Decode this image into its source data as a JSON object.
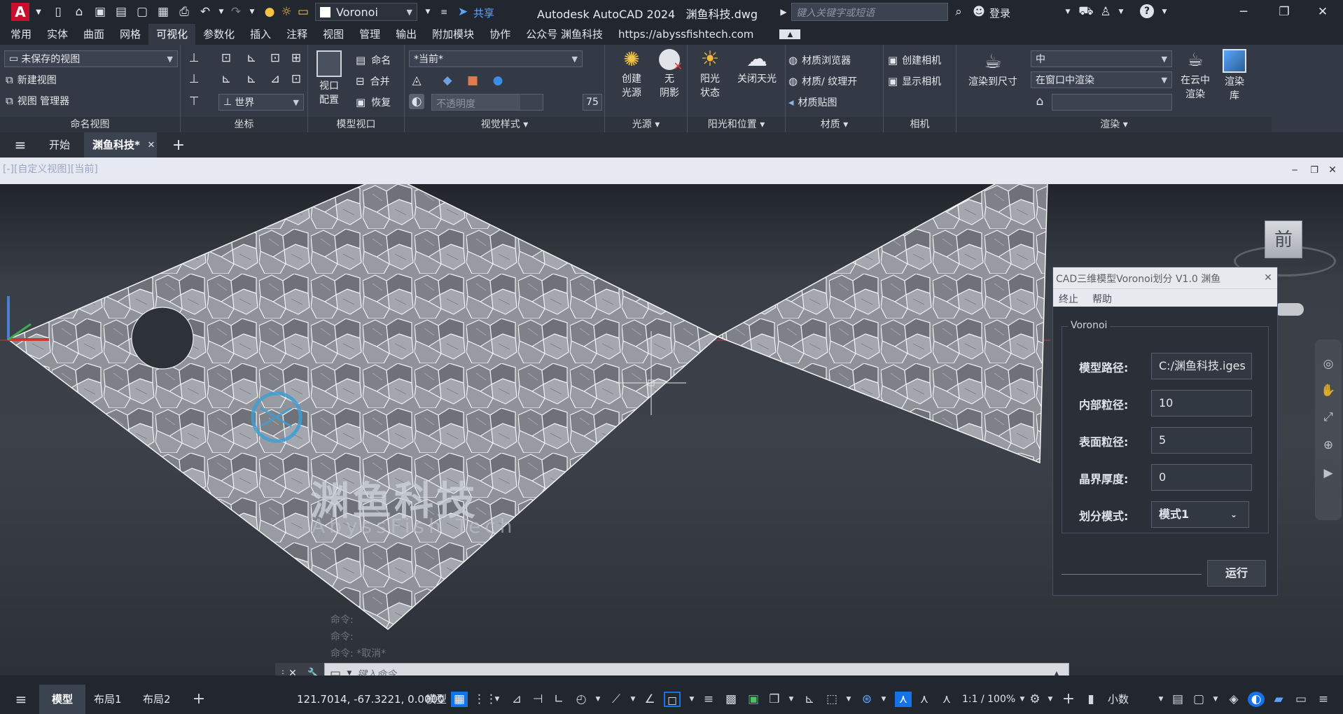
{
  "app": {
    "title": "Autodesk AutoCAD 2024   渊鱼科技.dwg",
    "logo_letter": "A",
    "workspace": "Voronoi",
    "share": "共享",
    "search_placeholder": "键入关键字或短语",
    "login": "登录"
  },
  "menu": {
    "items": [
      "常用",
      "实体",
      "曲面",
      "网格",
      "可视化",
      "参数化",
      "插入",
      "注释",
      "视图",
      "管理",
      "输出",
      "附加模块",
      "协作",
      "公众号 渊鱼科技",
      "https://abyssfishtech.com"
    ],
    "active": "可视化"
  },
  "ribbon": {
    "named_views": {
      "combo": "未保存的视图",
      "new_view": "新建视图",
      "view_manager": "视图 管理器",
      "panel": "命名视图"
    },
    "coordinates": {
      "world": "世界",
      "panel": "坐标"
    },
    "model_viewports": {
      "config": "视口\n配置",
      "config_l1": "视口",
      "config_l2": "配置",
      "name": "命名",
      "join": "合并",
      "restore": "恢复",
      "panel": "模型视口"
    },
    "visual_styles": {
      "current": "*当前*",
      "opacity_label": "不透明度",
      "opacity_value": "75",
      "panel": "视觉样式"
    },
    "lights": {
      "create_l1": "创建",
      "create_l2": "光源",
      "noshadow_l1": "无",
      "noshadow_l2": "阴影",
      "panel": "光源"
    },
    "sun": {
      "status_l1": "阳光",
      "status_l2": "状态",
      "sky_off": "关闭天光",
      "panel": "阳光和位置"
    },
    "materials": {
      "browser": "材质浏览器",
      "texture": "材质/ 纹理开",
      "mapping": "材质贴图",
      "panel": "材质"
    },
    "camera": {
      "create": "创建相机",
      "show": "显示相机",
      "panel": "相机"
    },
    "render": {
      "render_to_size": "渲染到尺寸",
      "quality": "中",
      "target": "在窗口中渲染",
      "cloud_l1": "在云中",
      "cloud_l2": "渲染",
      "gallery_l1": "渲染",
      "gallery_l2": "库",
      "panel": "渲染"
    }
  },
  "filetabs": {
    "start": "开始",
    "current": "渊鱼科技*"
  },
  "viewport": {
    "label": "[-][自定义视图][当前]",
    "viewcube_face": "前",
    "watermark_cn": "渊鱼科技",
    "watermark_en": "AbyssFish Tech",
    "cmd_history": [
      "命令:",
      "命令:",
      "命令:  *取消*"
    ],
    "cmd_placeholder": "键入命令"
  },
  "dialog": {
    "title": "CAD三维模型Voronoi划分 V1.0 渊鱼",
    "menu": [
      "终止",
      "帮助"
    ],
    "group": "Voronoi",
    "fields": [
      {
        "label": "模型路径:",
        "value": "C:/渊鱼科技.iges"
      },
      {
        "label": "内部粒径:",
        "value": "10"
      },
      {
        "label": "表面粒径:",
        "value": "5"
      },
      {
        "label": "晶界厚度:",
        "value": "0"
      },
      {
        "label": "划分模式:",
        "value": "模式1"
      }
    ],
    "run": "运行"
  },
  "statusbar": {
    "model": "模型",
    "layouts": [
      "布局1",
      "布局2"
    ],
    "coords": "121.7014, -67.3221, 0.0000",
    "mode": "模型",
    "scale": "1:1 / 100%",
    "units": "小数"
  },
  "colors": {
    "accent": "#1473e6",
    "logo_red": "#c8102e",
    "viewport_bg": "#3c414a"
  }
}
